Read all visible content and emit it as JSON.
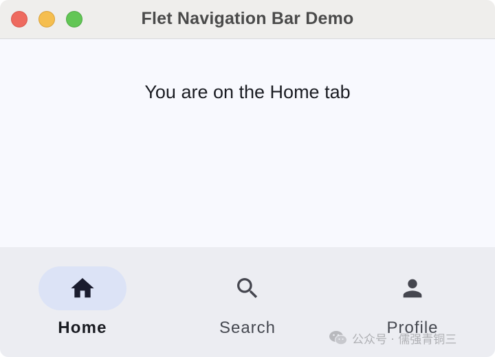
{
  "window": {
    "title": "Flet Navigation Bar Demo"
  },
  "content": {
    "message": "You are on the Home tab"
  },
  "navbar": {
    "selected_index": 0,
    "items": [
      {
        "label": "Home",
        "icon": "home-icon"
      },
      {
        "label": "Search",
        "icon": "search-icon"
      },
      {
        "label": "Profile",
        "icon": "person-icon"
      }
    ]
  },
  "watermark": {
    "text": "公众号 · 儒强青铜三",
    "icon": "wechat-icon"
  },
  "colors": {
    "background": "#f8f9fe",
    "titlebar": "#efeeec",
    "navbar": "#ecedf2",
    "indicator": "#dce3f6",
    "active_icon": "#1a1c2e",
    "inactive_icon": "#45464f"
  }
}
